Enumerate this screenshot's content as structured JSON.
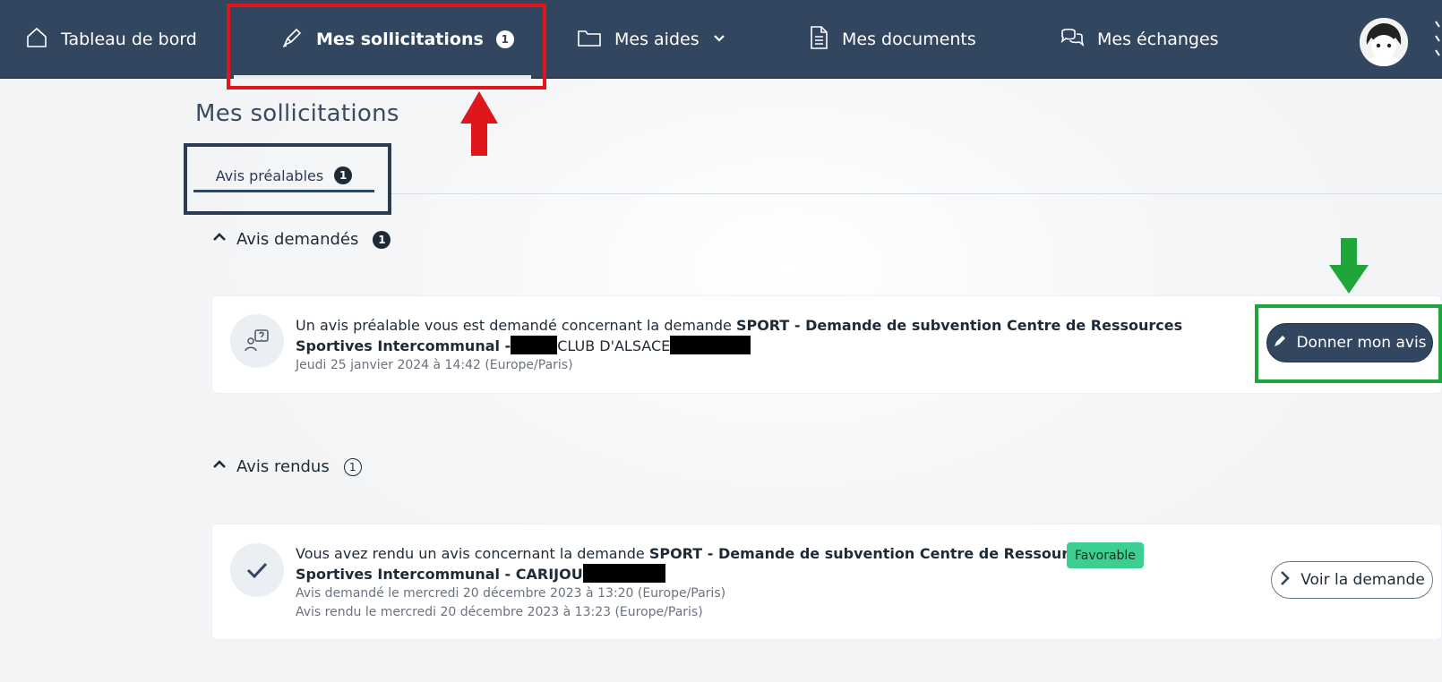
{
  "nav": {
    "items": [
      {
        "label": "Tableau de bord",
        "icon": "home-icon"
      },
      {
        "label": "Mes sollicitations",
        "icon": "pen-icon",
        "badge": "1",
        "active": true
      },
      {
        "label": "Mes aides",
        "icon": "folder-icon",
        "has_dropdown": true
      },
      {
        "label": "Mes documents",
        "icon": "document-icon"
      },
      {
        "label": "Mes échanges",
        "icon": "chat-icon"
      }
    ]
  },
  "page": {
    "title": "Mes sollicitations"
  },
  "tabs": [
    {
      "label": "Avis préalables",
      "badge": "1"
    }
  ],
  "sections": {
    "requested": {
      "title": "Avis demandés",
      "count": "1",
      "item": {
        "text_prefix": "Un avis préalable vous est demandé concernant la demande ",
        "title_line1": "SPORT - Demande de subvention Centre de Ressources",
        "title_line2_a": "Sportives Intercommunal -",
        "title_line2_b": "CLUB D'ALSACE",
        "date": "Jeudi 25 janvier 2024 à 14:42 (Europe/Paris)",
        "action_label": "Donner mon avis"
      }
    },
    "given": {
      "title": "Avis rendus",
      "count": "1",
      "item": {
        "text_prefix": "Vous avez rendu un avis concernant la demande ",
        "title_line1": "SPORT - Demande de subvention Centre de Ressources",
        "title_line2_a": "Sportives Intercommunal - CARIJOU",
        "requested_date": "Avis demandé le mercredi 20 décembre 2023 à 13:20 (Europe/Paris)",
        "given_date": "Avis rendu le mercredi 20 décembre 2023 à 13:23 (Europe/Paris)",
        "status": "Favorable",
        "action_label": "Voir la demande"
      }
    }
  },
  "colors": {
    "nav_bg": "#334660",
    "annotation_red": "#e0161d",
    "annotation_green": "#1ea63a",
    "annotation_navy": "#2b3b52",
    "status_favorable": "#3ccf91"
  }
}
